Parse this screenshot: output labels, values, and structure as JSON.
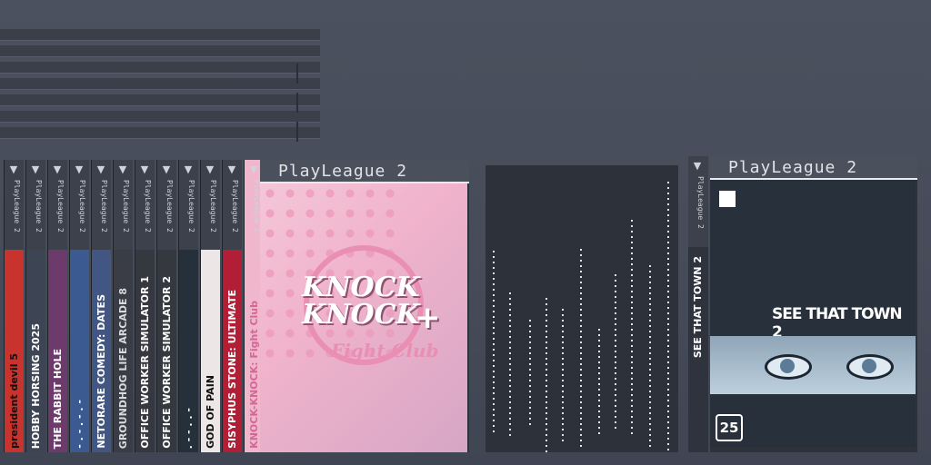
{
  "platform_name": "PlayLeague 2",
  "spine_platform_label": "PlayLeague 2",
  "games": [
    {
      "title": "president devil 5",
      "color": "#c9332e",
      "text_color": "#111111"
    },
    {
      "title": "HOBBY HORSING 2025",
      "color": "#3d4453",
      "text_color": "#ffffff"
    },
    {
      "title": "THE RABBIT HOLE",
      "color": "#6c3b6b",
      "text_color": "#ffffff"
    },
    {
      "title": "- . - . - . -",
      "color": "#3b5a92",
      "text_color": "#ffffff"
    },
    {
      "title": "NETORARE COMEDY: DATES",
      "color": "#425683",
      "text_color": "#ffffff"
    },
    {
      "title": "GROUNDHOG LIFE ARCADE 8",
      "color": "#3a3d45",
      "text_color": "#d8dade"
    },
    {
      "title": "OFFICE WORKER SIMULATOR 1",
      "color": "#35383f",
      "text_color": "#ffffff"
    },
    {
      "title": "OFFICE WORKER SIMULATOR 2",
      "color": "#35383f",
      "text_color": "#ffffff"
    },
    {
      "title": ". - - . . -",
      "color": "#25303b",
      "text_color": "#ffffff"
    },
    {
      "title": "GOD OF PAIN",
      "color": "#ece6e6",
      "text_color": "#111111"
    },
    {
      "title": "SISYPHUS STONE: ULTIMATE",
      "color": "#b31e37",
      "text_color": "#ffffff"
    },
    {
      "title": "KNOCK-KNOCK: Fight Club",
      "color": "#f0b6cc",
      "text_color": "#d46796"
    }
  ],
  "featured": {
    "title_line1": "KNOCK",
    "title_line2": "KNOCK",
    "title_plus": "+",
    "subtitle": "Fight Club"
  },
  "second_case": {
    "spine_title": "SEE THAT TOWN 2",
    "cover_title": "SEE THAT TOWN 2",
    "age_rating": "25"
  }
}
